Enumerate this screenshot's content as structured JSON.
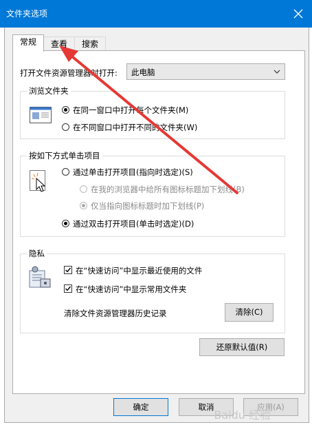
{
  "window": {
    "title": "文件夹选项"
  },
  "tabs": [
    {
      "label": "常规",
      "active": true
    },
    {
      "label": "查看",
      "active": false
    },
    {
      "label": "搜索",
      "active": false
    }
  ],
  "open_explorer": {
    "label": "打开文件资源管理器时打开:",
    "value": "此电脑"
  },
  "browse": {
    "title": "浏览文件夹",
    "options": [
      {
        "label": "在同一窗口中打开每个文件夹(M)",
        "checked": true
      },
      {
        "label": "在不同窗口中打开不同的文件夹(W)",
        "checked": false
      }
    ]
  },
  "click_items": {
    "title": "按如下方式单击项目",
    "single_click": "通过单击打开项目(指向时选定)(S)",
    "underline_browser": "在我的浏览器中给所有图标标题加下划线(B)",
    "underline_point": "仅当指向图标标题时加下划线(P)",
    "double_click": "通过双击打开项目(单击时选定)(D)"
  },
  "privacy": {
    "title": "隐私",
    "recent_files": "在“快速访问”中显示最近使用的文件",
    "frequent_folders": "在“快速访问”中显示常用文件夹",
    "clear_history_label": "清除文件资源管理器历史记录",
    "clear_button": "清除(C)"
  },
  "restore_defaults": "还原默认值(R)",
  "footer": {
    "ok": "确定",
    "cancel": "取消",
    "apply": "应用(A)"
  },
  "watermark": "Baidu 经验",
  "colors": {
    "titlebar": "#0078d7",
    "arrow": "#e53935"
  }
}
